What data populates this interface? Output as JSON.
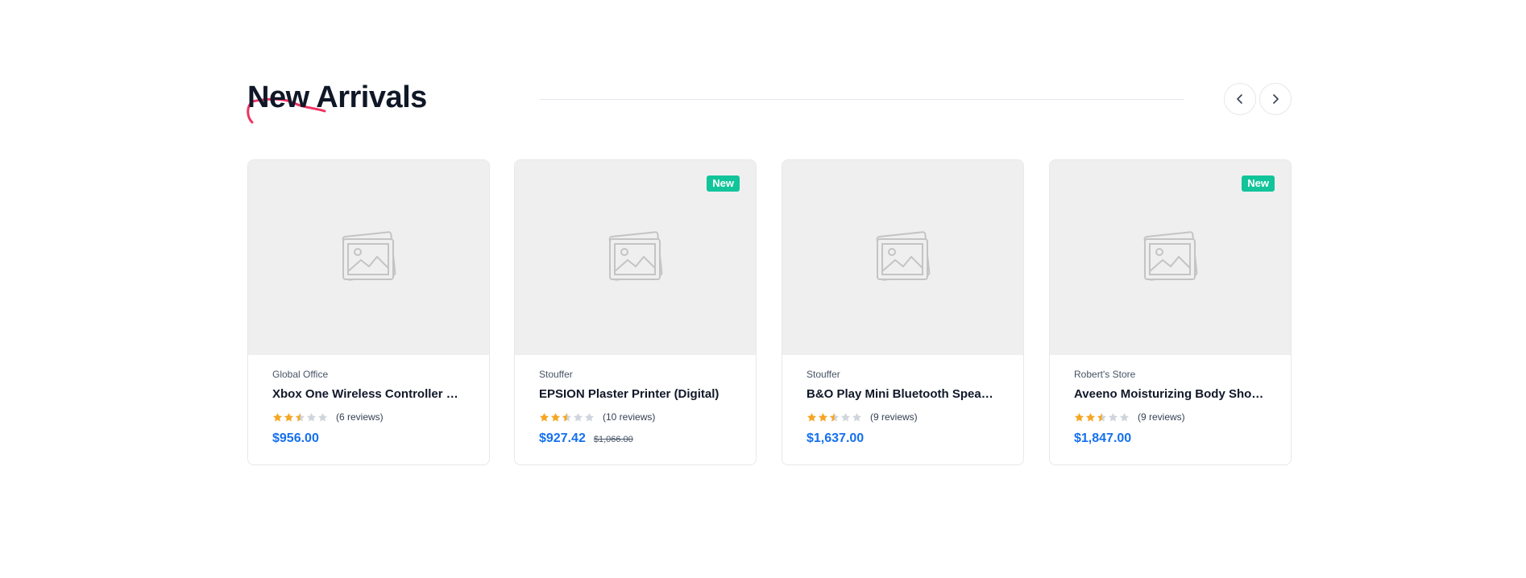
{
  "section": {
    "title": "New Arrivals",
    "accent_color": "#ee3463",
    "prev_icon": "chevron-left-icon",
    "next_icon": "chevron-right-icon"
  },
  "products": [
    {
      "store": "Global Office",
      "name": "Xbox One Wireless Controller Black Color",
      "rating": 2.5,
      "max_rating": 5,
      "reviews": "(6 reviews)",
      "price": "$956.00",
      "old_price": "",
      "badge": "",
      "image_icon": "image-placeholder-icon"
    },
    {
      "store": "Stouffer",
      "name": "EPSION Plaster Printer (Digital)",
      "rating": 2.5,
      "max_rating": 5,
      "reviews": "(10 reviews)",
      "price": "$927.42",
      "old_price": "$1,066.00",
      "badge": "New",
      "image_icon": "image-placeholder-icon"
    },
    {
      "store": "Stouffer",
      "name": "B&O Play Mini Bluetooth Speaker",
      "rating": 2.5,
      "max_rating": 5,
      "reviews": "(9 reviews)",
      "price": "$1,637.00",
      "old_price": "",
      "badge": "",
      "image_icon": "image-placeholder-icon"
    },
    {
      "store": "Robert's Store",
      "name": "Aveeno Moisturizing Body Shower Gel",
      "rating": 2.5,
      "max_rating": 5,
      "reviews": "(9 reviews)",
      "price": "$1,847.00",
      "old_price": "",
      "badge": "New",
      "image_icon": "image-placeholder-icon"
    }
  ],
  "colors": {
    "star_filled": "#f5a623",
    "star_empty": "#d0d5dd",
    "price": "#1570ef",
    "badge": "#12c49a"
  }
}
